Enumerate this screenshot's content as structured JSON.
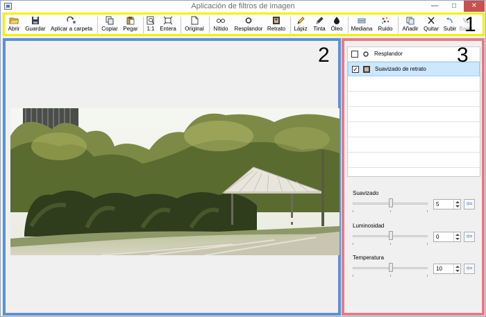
{
  "window": {
    "title": "Aplicación de filtros de imagen",
    "controls": {
      "minimize": "—",
      "maximize": "□",
      "close": "✕"
    }
  },
  "toolbar": {
    "buttons": [
      {
        "label": "Abrir",
        "icon": "folder-open-icon",
        "enabled": true
      },
      {
        "label": "Guardar",
        "icon": "save-disk-icon",
        "enabled": true
      },
      {
        "label": "Aplicar a carpeta",
        "icon": "apply-folder-icon",
        "enabled": true
      },
      {
        "label": "Copiar",
        "icon": "copy-icon",
        "enabled": true
      },
      {
        "label": "Pegar",
        "icon": "paste-icon",
        "enabled": true
      },
      {
        "label": "1:1",
        "icon": "zoom-actual-icon",
        "enabled": true
      },
      {
        "label": "Entera",
        "icon": "fit-whole-icon",
        "enabled": true
      },
      {
        "label": "Original",
        "icon": "page-icon",
        "enabled": true
      },
      {
        "label": "Nítido",
        "icon": "glasses-icon",
        "enabled": true
      },
      {
        "label": "Resplandor",
        "icon": "glow-ring-icon",
        "enabled": true
      },
      {
        "label": "Retrato",
        "icon": "portrait-icon",
        "enabled": true
      },
      {
        "label": "Lápiz",
        "icon": "pencil-icon",
        "enabled": true
      },
      {
        "label": "Tinta",
        "icon": "pen-icon",
        "enabled": true
      },
      {
        "label": "Óleo",
        "icon": "oil-drop-icon",
        "enabled": true
      },
      {
        "label": "Mediana",
        "icon": "median-icon",
        "enabled": true
      },
      {
        "label": "Ruido",
        "icon": "noise-icon",
        "enabled": true
      },
      {
        "label": "Añadir",
        "icon": "add-filter-icon",
        "enabled": true
      },
      {
        "label": "Quitar",
        "icon": "remove-x-icon",
        "enabled": true
      },
      {
        "label": "Subir",
        "icon": "move-up-icon",
        "enabled": true
      },
      {
        "label": "Bajar",
        "icon": "move-down-icon",
        "enabled": false
      }
    ]
  },
  "regions": {
    "one": "1",
    "two": "2",
    "three": "3"
  },
  "filters": {
    "items": [
      {
        "label": "Resplandor",
        "checked": false,
        "selected": false,
        "icon": "glow-ring-icon"
      },
      {
        "label": "Suavizado de retrato",
        "checked": true,
        "selected": true,
        "icon": "portrait-icon"
      }
    ]
  },
  "properties": {
    "items": [
      {
        "label": "Suavizado",
        "value": "5"
      },
      {
        "label": "Luminosidad",
        "value": "0"
      },
      {
        "label": "Temperatura",
        "value": "10"
      }
    ],
    "reset_icon": "reset-arrow-icon"
  },
  "colors": {
    "toolbar_highlight": "#f4f100",
    "left_highlight": "#5f8fd0",
    "right_highlight": "#e47c87",
    "selection": "#cce8ff"
  }
}
